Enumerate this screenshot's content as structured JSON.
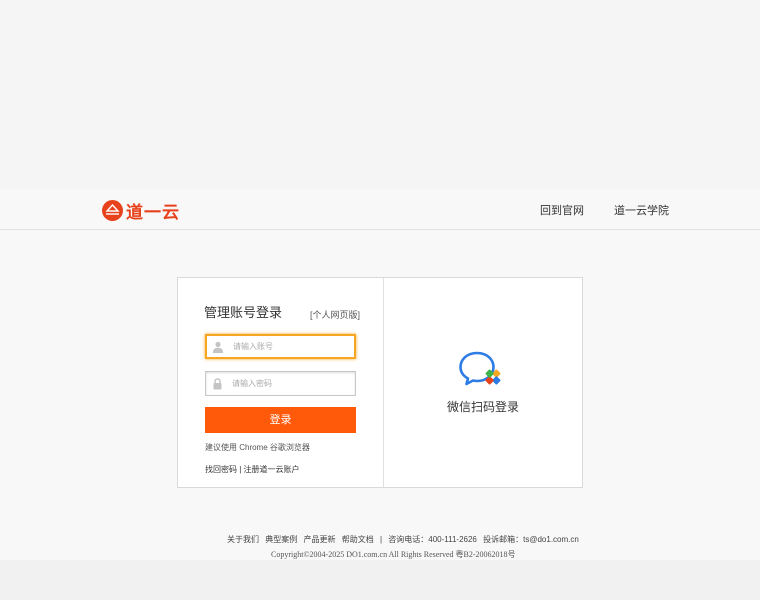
{
  "header": {
    "logo_text": "道一云",
    "nav_home": "回到官网",
    "nav_academy": "道一云学院"
  },
  "login": {
    "title": "管理账号登录",
    "personal_link": "[个人网页版]",
    "account_placeholder": "请输入账号",
    "password_placeholder": "请输入密码",
    "submit_label": "登录",
    "browser_tip": "建议使用 Chrome 谷歌浏览器",
    "forgot_password": "找回密码",
    "separator": " | ",
    "register": "注册道一云账户"
  },
  "wechat": {
    "label": "微信扫码登录",
    "icon": "wechat-chat-icon"
  },
  "footer": {
    "links": [
      "关于我们",
      "典型案例",
      "产品更新",
      "帮助文档",
      "|",
      "咨询电话：400-111-2626",
      "投诉邮箱：ts@do1.com.cn"
    ],
    "copyright": "Copyright©2004-2025 DO1.com.cn All Rights Reserved 粤B2-20062018号"
  },
  "colors": {
    "brand": "#e8421c",
    "button": "#ff5a0a",
    "focus_border": "#f5a623",
    "wechat_blue": "#2d7be5"
  }
}
